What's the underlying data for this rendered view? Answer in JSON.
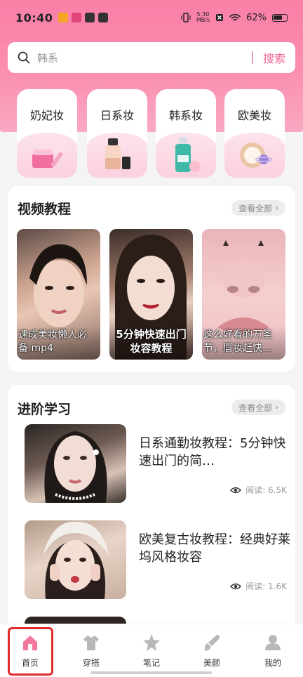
{
  "status_bar": {
    "time": "10:40",
    "net_speed_top": "5.30",
    "net_speed_bottom": "MB/s",
    "battery": "62%"
  },
  "search": {
    "placeholder": "韩系",
    "button": "搜索"
  },
  "categories": [
    {
      "label": "奶妃妆",
      "icon": "skincare-jar-icon"
    },
    {
      "label": "日系妆",
      "icon": "foundation-bottle-icon"
    },
    {
      "label": "韩系妆",
      "icon": "toner-bottle-icon"
    },
    {
      "label": "欧美妆",
      "icon": "compact-mirror-icon"
    }
  ],
  "video_section": {
    "title": "视频教程",
    "see_all": "查看全部",
    "videos": [
      {
        "caption": "速成美妆懒人必备.mp4"
      },
      {
        "caption": "5分钟快速出门妆容教程"
      },
      {
        "caption": "这么好看的万圣节，唇妆赶快…"
      }
    ]
  },
  "advanced_section": {
    "title": "进阶学习",
    "see_all": "查看全部",
    "articles": [
      {
        "title": "日系通勤妆教程：5分钟快速出门的简…",
        "reads": "阅读: 6.5K"
      },
      {
        "title": "欧美复古妆教程：经典好莱坞风格妆容",
        "reads": "阅读: 1.6K"
      }
    ]
  },
  "tabbar": {
    "active": "首页",
    "tabs": [
      {
        "label": "首页",
        "icon": "home-icon"
      },
      {
        "label": "穿搭",
        "icon": "tshirt-icon"
      },
      {
        "label": "笔记",
        "icon": "star-icon"
      },
      {
        "label": "美颜",
        "icon": "brush-icon"
      },
      {
        "label": "我的",
        "icon": "person-icon"
      }
    ]
  },
  "colors": {
    "accent": "#f06292",
    "header": "#fa7fa6",
    "highlight_frame": "#e22a2a"
  }
}
